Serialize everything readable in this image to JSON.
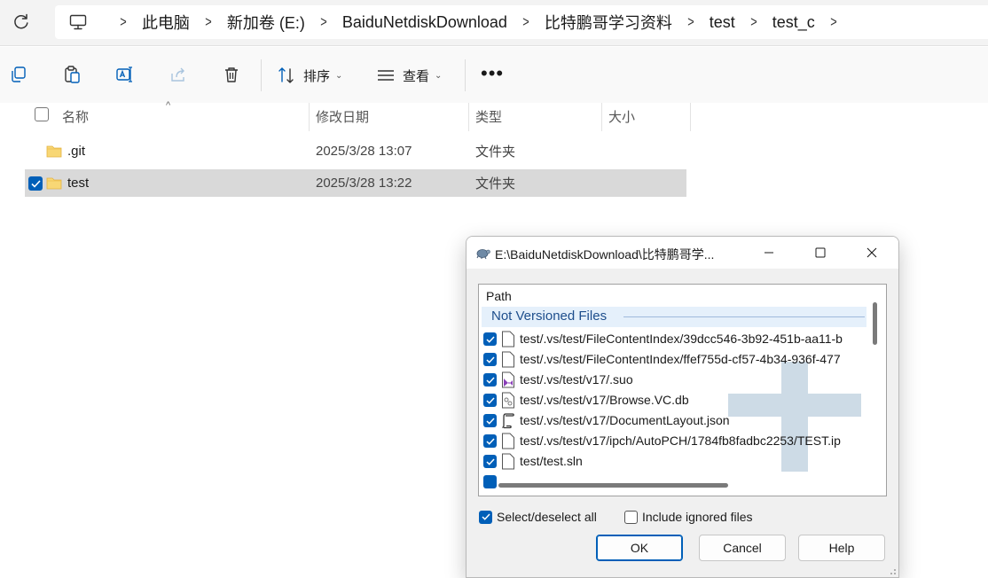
{
  "address_bar": {
    "breadcrumb": [
      "此电脑",
      "新加卷 (E:)",
      "BaiduNetdiskDownload",
      "比特鹏哥学习资料",
      "test",
      "test_c"
    ]
  },
  "toolbar": {
    "sort_label": "排序",
    "view_label": "查看",
    "more_label": "•••"
  },
  "columns": {
    "name": "名称",
    "date": "修改日期",
    "type": "类型",
    "size": "大小"
  },
  "files": [
    {
      "name": ".git",
      "date": "2025/3/28 13:07",
      "type": "文件夹",
      "selected": false
    },
    {
      "name": "test",
      "date": "2025/3/28 13:22",
      "type": "文件夹",
      "selected": true
    }
  ],
  "dialog": {
    "title": "E:\\BaiduNetdiskDownload\\比特鹏哥学...",
    "path_header": "Path",
    "group_label": "Not Versioned Files",
    "entries": [
      {
        "path": "test/.vs/test/FileContentIndex/39dcc546-3b92-451b-aa11-b",
        "icon": "blank-file-icon",
        "checked": true
      },
      {
        "path": "test/.vs/test/FileContentIndex/ffef755d-cf57-4b34-936f-477",
        "icon": "blank-file-icon",
        "checked": true
      },
      {
        "path": "test/.vs/test/v17/.suo",
        "icon": "visual-studio-file-icon",
        "checked": true
      },
      {
        "path": "test/.vs/test/v17/Browse.VC.db",
        "icon": "database-file-icon",
        "checked": true
      },
      {
        "path": "test/.vs/test/v17/DocumentLayout.json",
        "icon": "json-file-icon",
        "checked": true
      },
      {
        "path": "test/.vs/test/v17/ipch/AutoPCH/1784fb8fadbc2253/TEST.ip",
        "icon": "blank-file-icon",
        "checked": true
      },
      {
        "path": "test/test.sln",
        "icon": "blank-file-icon",
        "checked": true
      }
    ],
    "select_all_label": "Select/deselect all",
    "select_all_checked": true,
    "include_ignored_label": "Include ignored files",
    "include_ignored_checked": false,
    "ok_label": "OK",
    "cancel_label": "Cancel",
    "help_label": "Help"
  },
  "colors": {
    "accent": "#005fb8",
    "selected_row": "#d9d9d9",
    "group_label": "#1e4e8c",
    "folder": "#f8d775"
  }
}
